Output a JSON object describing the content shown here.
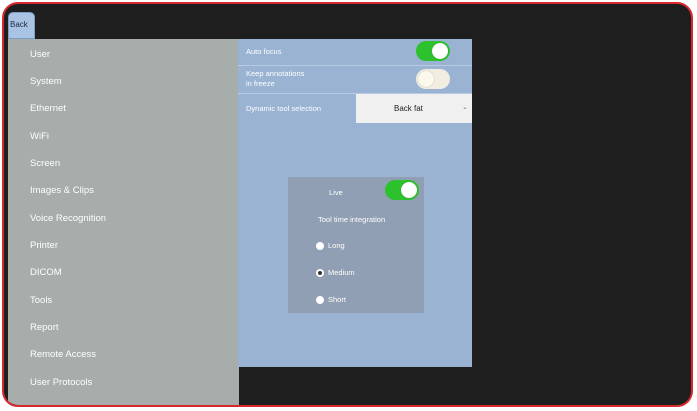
{
  "back_label": "Back",
  "sidebar": {
    "items": [
      {
        "label": "User"
      },
      {
        "label": "System"
      },
      {
        "label": "Ethernet"
      },
      {
        "label": "WiFi"
      },
      {
        "label": "Screen"
      },
      {
        "label": "Images & Clips"
      },
      {
        "label": "Voice Recognition"
      },
      {
        "label": "Printer"
      },
      {
        "label": "DICOM"
      },
      {
        "label": "Tools"
      },
      {
        "label": "Report"
      },
      {
        "label": "Remote Access"
      },
      {
        "label": "User Protocols"
      }
    ]
  },
  "settings": {
    "auto_focus": {
      "label": "Auto focus",
      "state": "on"
    },
    "keep_annotations": {
      "label": "Keep annotations\nin freeze",
      "state": "off"
    },
    "dynamic_tool_selection": {
      "label": "Dynamic tool selection",
      "value": "Back fat"
    }
  },
  "live_panel": {
    "live_label": "Live",
    "live_state": "on",
    "tool_time_integration_label": "Tool time integration",
    "options": [
      "Long",
      "Medium",
      "Short"
    ],
    "selected": "Medium"
  },
  "icons": {
    "select_chevron": "chevron-down-icon"
  },
  "colors": {
    "frame_border": "#d8282f",
    "toggle_on": "#2ec12e",
    "sidebar_bg": "#a6adaa",
    "panel_bg": "#9ab3d3",
    "subpanel_bg": "#909fb3",
    "back_button": "#a9c3e4"
  }
}
